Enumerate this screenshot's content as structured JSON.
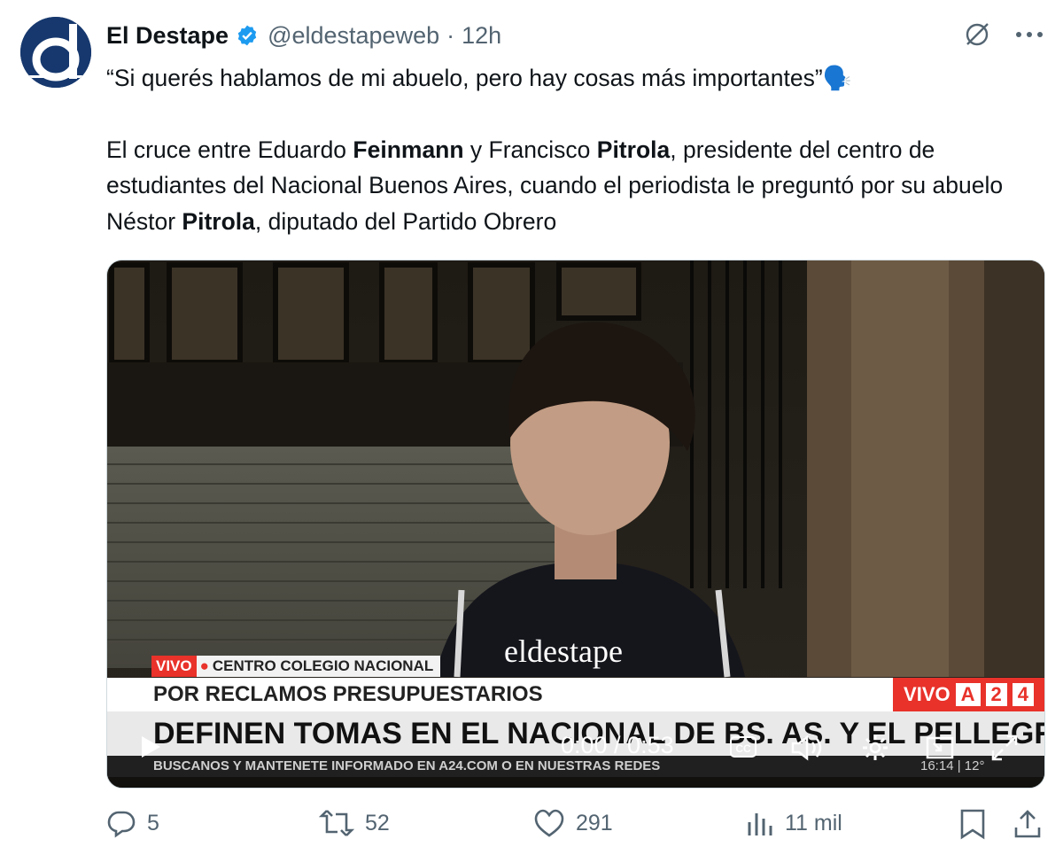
{
  "tweet": {
    "author_name": "El Destape",
    "author_handle": "@eldestapeweb",
    "separator": "·",
    "time": "12h",
    "avatar_letter": "d",
    "line1": "“Si querés hablamos de mi abuelo, pero hay cosas más importantes”🗣️",
    "p2_a": "El cruce entre Eduardo ",
    "p2_b": "Feinmann",
    "p2_c": " y Francisco ",
    "p2_d": "Pitrola",
    "p2_e": ", presidente del centro de estudiantes del Nacional Buenos Aires, cuando el periodista le preguntó por su abuelo Néstor ",
    "p2_f": "Pitrola",
    "p2_g": ", diputado del Partido Obrero"
  },
  "video": {
    "vivo_tag": "VIVO",
    "location": "CENTRO COLEGIO NACIONAL",
    "subtitle": "POR RECLAMOS PRESUPUESTARIOS",
    "headline": "DEFINEN TOMAS EN EL NACIONAL DE BS. AS. Y EL PELLEGRINI",
    "ticker": "BUSCANOS Y MANTENETE INFORMADO EN A24.COM O EN NUESTRAS REDES",
    "channel_vivo": "VIVO",
    "channel_logo": [
      "A",
      "2",
      "4"
    ],
    "clock": "16:14 | 12°",
    "watermark": "eldestape",
    "time_display": "0:00 / 0:53",
    "cc_label": "CC"
  },
  "actions": {
    "replies": "5",
    "reposts": "52",
    "likes": "291",
    "views": "11 mil"
  },
  "colors": {
    "verified": "#1d9bf0",
    "muted": "#536471",
    "a24_red": "#e8322a",
    "avatar_bg": "#16386e"
  },
  "icons": [
    "verified-badge-icon",
    "grok-icon",
    "more-icon",
    "reply-icon",
    "repost-icon",
    "like-icon",
    "views-icon",
    "bookmark-icon",
    "share-icon",
    "play-icon",
    "cc-icon",
    "volume-icon",
    "settings-icon",
    "pip-icon",
    "fullscreen-icon"
  ]
}
